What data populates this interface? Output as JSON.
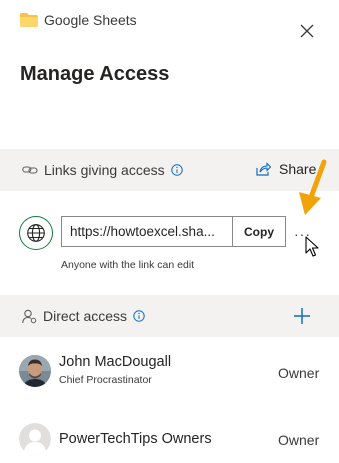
{
  "breadcrumb": {
    "location": "Google Sheets"
  },
  "panel": {
    "title": "Manage Access"
  },
  "links_section": {
    "label": "Links giving access",
    "share_label": "Share",
    "link_url": "https://howtoexcel.sha...",
    "copy_label": "Copy",
    "more_label": "···",
    "caption": "Anyone with the link can edit"
  },
  "direct_section": {
    "label": "Direct access"
  },
  "people": [
    {
      "name": "John MacDougall",
      "role": "Chief Procrastinator",
      "permission": "Owner"
    },
    {
      "name": "PowerTechTips Owners",
      "role": "",
      "permission": "Owner"
    }
  ],
  "colors": {
    "accent": "#0f6cbd",
    "globe_ring": "#107c41",
    "annotation_arrow": "#f2a20a",
    "folder": "#f6c343"
  },
  "icons": [
    "folder-icon",
    "close-icon",
    "link-icon",
    "info-icon",
    "share-icon",
    "globe-icon",
    "more-icon",
    "person-icon",
    "plus-icon",
    "avatar",
    "arrow-annotation",
    "mouse-cursor-icon"
  ]
}
